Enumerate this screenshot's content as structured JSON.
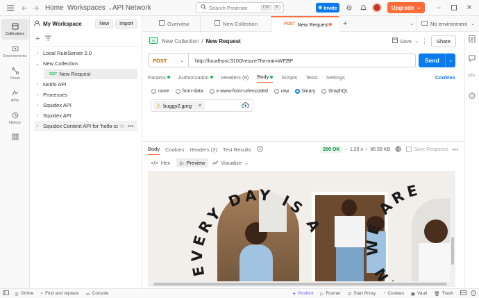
{
  "titlebar": {
    "home": "Home",
    "workspaces": "Workspaces",
    "api_network": "API Network",
    "search_placeholder": "Search Postman",
    "shortcut_ctrl": "Ctrl",
    "shortcut_k": "K",
    "invite": "Invite",
    "upgrade": "Upgrade"
  },
  "rail": [
    {
      "label": "Collections",
      "icon": "collections-icon"
    },
    {
      "label": "Environments",
      "icon": "environments-icon"
    },
    {
      "label": "Flows",
      "icon": "flows-icon"
    },
    {
      "label": "APIs",
      "icon": "apis-icon"
    },
    {
      "label": "History",
      "icon": "history-icon"
    }
  ],
  "panel": {
    "workspace": "My Workspace",
    "new_btn": "New",
    "import_btn": "Import",
    "items": [
      {
        "label": "Local RuleServer 2.0",
        "expanded": false
      },
      {
        "label": "New Collection",
        "expanded": true
      },
      {
        "label": "Notifo API",
        "expanded": false
      },
      {
        "label": "Processes",
        "expanded": false
      },
      {
        "label": "Squidex API",
        "expanded": false
      },
      {
        "label": "Squidex API",
        "expanded": false
      },
      {
        "label": "Squidex Content API for 'hello-sq...",
        "expanded": false
      }
    ],
    "child": {
      "method": "GET",
      "label": "New Request"
    }
  },
  "tabs": {
    "overview": "Overview",
    "new_collection": "New Collection",
    "active_method": "POST",
    "active_label": "New Request",
    "environment": "No environment"
  },
  "request": {
    "breadcrumb_parent": "New Collection",
    "breadcrumb_sep": "/",
    "breadcrumb_current": "New Request",
    "save": "Save",
    "share": "Share",
    "method": "POST",
    "url": "http://localhost:3100/resize?format=WEBP",
    "send": "Send",
    "cookies": "Cookies",
    "subtabs": [
      "Params",
      "Authorization",
      "Headers (9)",
      "Body",
      "Scripts",
      "Tests",
      "Settings"
    ],
    "body_modes": [
      "none",
      "form-data",
      "x-www-form-urlencoded",
      "raw",
      "binary",
      "GraphQL"
    ],
    "file": "buggy2.jpeg"
  },
  "response": {
    "tabs": [
      "Body",
      "Cookies",
      "Headers (3)",
      "Test Results"
    ],
    "status": "200 OK",
    "time": "1.20 s",
    "size": "85.59 KB",
    "save_response": "Save Response",
    "views": [
      "Hex",
      "Preview",
      "Visualize"
    ],
    "preview_text": [
      "EVERY DAY IS A GREA",
      "EN WE ARE"
    ]
  },
  "statusbar": {
    "online": "Online",
    "find": "Find and replace",
    "console": "Console",
    "postbot": "Postbot",
    "runner": "Runner",
    "proxy": "Start Proxy",
    "cookies": "Cookies",
    "vault": "Vault",
    "trash": "Trash"
  },
  "colors": {
    "accent": "#ff6c37",
    "primary": "#097bed",
    "success": "#0cbb52"
  }
}
